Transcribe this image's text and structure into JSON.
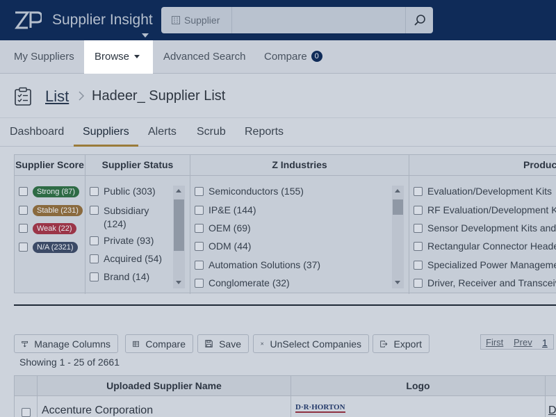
{
  "app": {
    "title": "Supplier Insight",
    "colors": {
      "header_bg": "#0f2b58",
      "active_tab_underline": "#9a7b3a"
    }
  },
  "search": {
    "scope_label": "Supplier",
    "placeholder": "",
    "value": ""
  },
  "nav": {
    "my_suppliers": "My Suppliers",
    "browse": "Browse",
    "advanced_search": "Advanced Search",
    "compare": "Compare",
    "compare_count": "0"
  },
  "breadcrumb": {
    "list_link": "List",
    "current": "Hadeer_ Supplier List"
  },
  "tabs": {
    "dashboard": "Dashboard",
    "suppliers": "Suppliers",
    "alerts": "Alerts",
    "scrub": "Scrub",
    "reports": "Reports"
  },
  "filters": {
    "supplier_score": {
      "header": "Supplier Score",
      "items": [
        {
          "label": "Strong (87)",
          "color": "#2e6b45"
        },
        {
          "label": "Stable (231)",
          "color": "#8a6a3e"
        },
        {
          "label": "Weak (22)",
          "color": "#9b3548"
        },
        {
          "label": "N/A (2321)",
          "color": "#3b4a66"
        }
      ]
    },
    "supplier_status": {
      "header": "Supplier Status",
      "items": [
        "Public (303)",
        "Subsidiary",
        "(124)",
        "Private (93)",
        "Acquired (54)",
        "Brand (14)"
      ]
    },
    "z_industries": {
      "header": "Z Industries",
      "items": [
        "Semiconductors (155)",
        "IP&E (144)",
        "OEM (69)",
        "ODM (44)",
        "Automation Solutions (37)",
        "Conglomerate (32)"
      ]
    },
    "products": {
      "header": "Product",
      "items": [
        "Evaluation/Development Kits",
        "RF Evaluation/Development K",
        "Sensor Development Kits and",
        "Rectangular Connector Heade",
        "Specialized Power Manageme",
        "Driver, Receiver and Transceiv"
      ]
    }
  },
  "toolbar": {
    "manage_columns": "Manage Columns",
    "compare": "Compare",
    "save": "Save",
    "unselect": "UnSelect Companies",
    "export": "Export"
  },
  "pagination": {
    "first": "First",
    "prev": "Prev",
    "page": "1"
  },
  "results": {
    "showing": "Showing 1 - 25 of 2661"
  },
  "table": {
    "columns": [
      "Uploaded Supplier Name",
      "Logo"
    ],
    "rows": [
      {
        "name": "Accenture Corporation",
        "logo_text": "D·R·HORTON",
        "next_col": "D"
      }
    ]
  }
}
